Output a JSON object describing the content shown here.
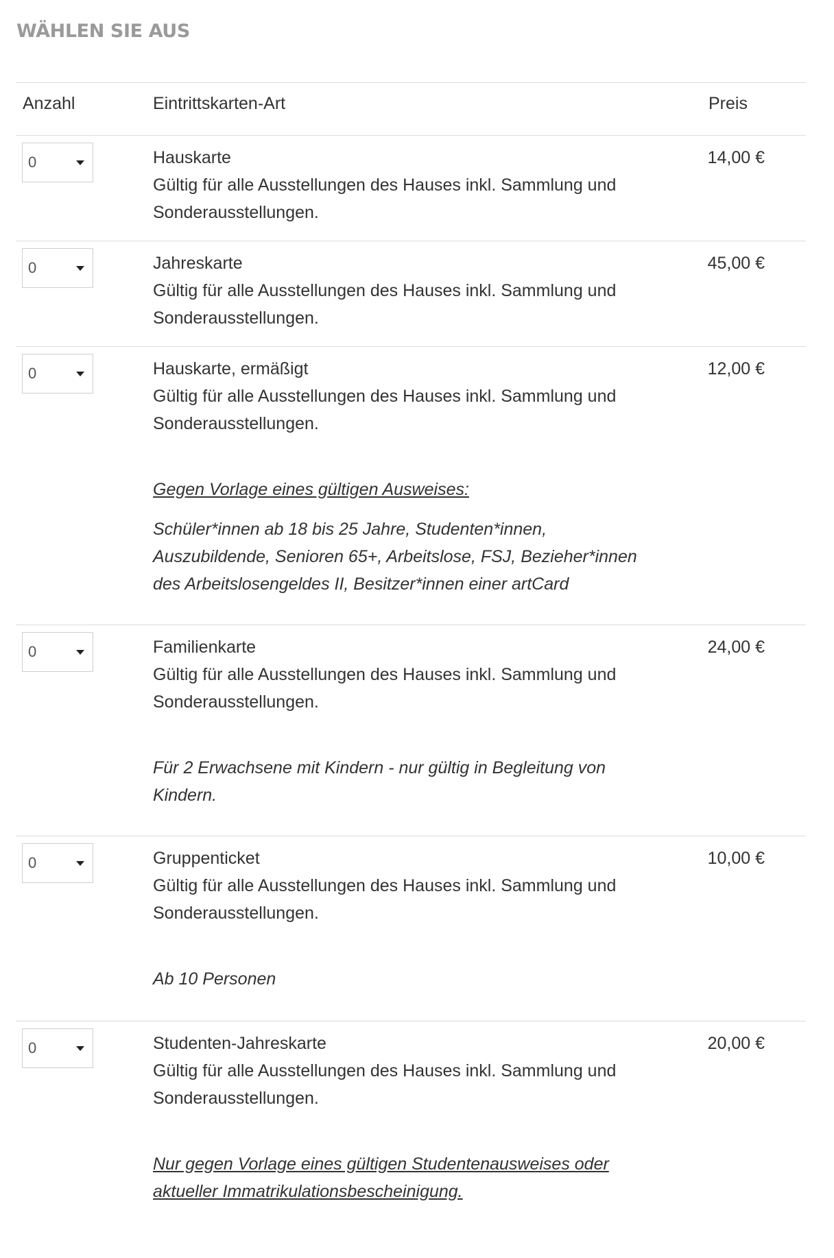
{
  "section_title": "WÄHLEN SIE AUS",
  "table": {
    "headers": {
      "quantity": "Anzahl",
      "type": "Eintrittskarten-Art",
      "price": "Preis"
    },
    "rows": [
      {
        "quantity": "0",
        "name": "Hauskarte",
        "description": "Gültig für alle Ausstellungen des Hauses inkl. Sammlung und Sonderausstellungen.",
        "price": "14,00 €"
      },
      {
        "quantity": "0",
        "name": "Jahreskarte",
        "description": "Gültig für alle Ausstellungen des Hauses inkl. Sammlung und Sonderausstellungen.",
        "price": "45,00 €"
      },
      {
        "quantity": "0",
        "name": "Hauskarte, ermäßigt",
        "description": "Gültig für alle Ausstellungen des Hauses inkl. Sammlung und Sonderausstellungen.",
        "note_heading": "Gegen Vorlage eines gültigen Ausweises:",
        "note": "Schüler*innen ab 18 bis 25 Jahre, Studenten*innen, Auszubildende, Senioren 65+, Arbeitslose, FSJ, Bezieher*innen des Arbeitslosengeldes II, Besitzer*innen einer artCard",
        "price": "12,00 €"
      },
      {
        "quantity": "0",
        "name": "Familienkarte",
        "description": "Gültig für alle Ausstellungen des Hauses inkl. Sammlung und Sonderausstellungen.",
        "note": "Für 2 Erwachsene mit Kindern - nur gültig in Begleitung von Kindern.",
        "price": "24,00 €"
      },
      {
        "quantity": "0",
        "name": "Gruppenticket",
        "description": "Gültig für alle Ausstellungen des Hauses inkl. Sammlung und Sonderausstellungen.",
        "note": "Ab 10 Personen",
        "price": "10,00 €"
      },
      {
        "quantity": "0",
        "name": "Studenten-Jahreskarte",
        "description": "Gültig für alle Ausstellungen des Hauses inkl. Sammlung und Sonderausstellungen.",
        "note_link": "Nur gegen Vorlage eines gültigen Studentenausweises oder aktueller Immatrikulationsbescheinigung.",
        "price": "20,00 €"
      }
    ]
  }
}
